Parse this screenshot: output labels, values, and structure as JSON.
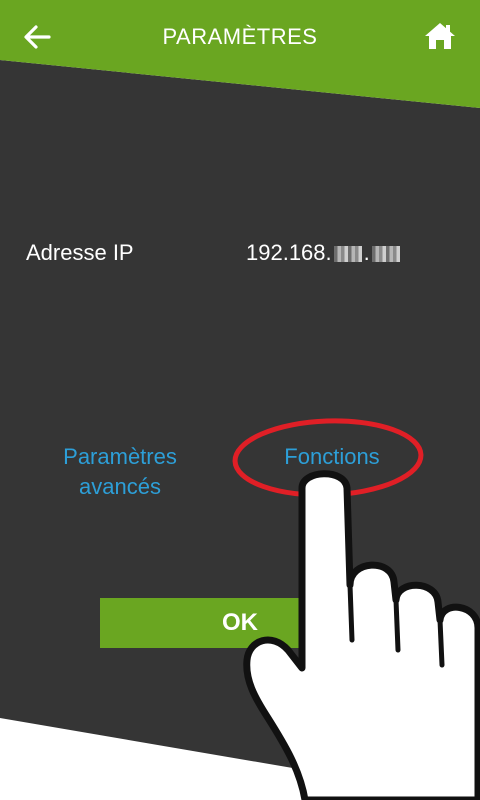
{
  "header": {
    "title": "PARAMÈTRES",
    "back_icon": "arrow-left-icon",
    "home_icon": "home-icon"
  },
  "settings": {
    "ip_label": "Adresse IP",
    "ip_prefix": "192.168.",
    "ip_dot": "."
  },
  "links": {
    "advanced_line1": "Paramètres",
    "advanced_line2": "avancés",
    "functions": "Fonctions"
  },
  "buttons": {
    "ok_label": "OK"
  },
  "colors": {
    "header_green": "#6aa621",
    "panel_dark": "#353535",
    "link_blue": "#2d9fd8",
    "highlight_red": "#e01f26"
  }
}
